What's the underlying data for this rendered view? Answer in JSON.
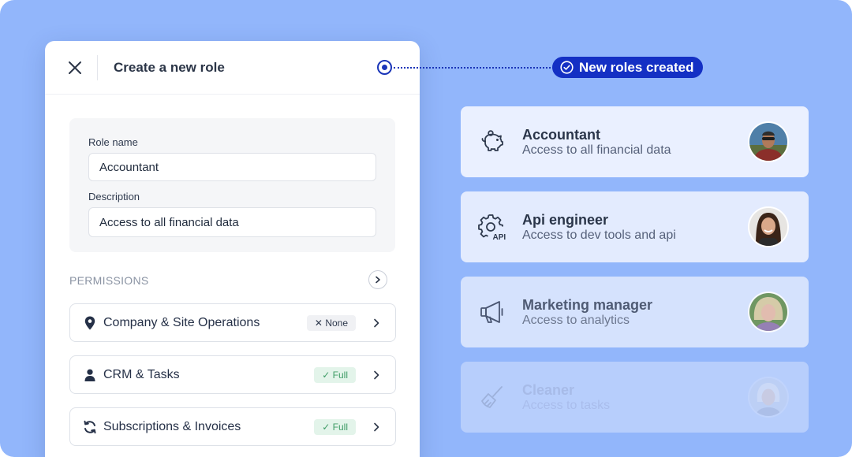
{
  "modal": {
    "title": "Create a new role",
    "form": {
      "role_name_label": "Role name",
      "role_name_value": "Accountant",
      "description_label": "Description",
      "description_value": "Access to all financial data"
    },
    "permissions": {
      "heading": "PERMISSIONS",
      "rows": [
        {
          "label": "Company & Site Operations",
          "icon": "location-pin-icon",
          "badge": "None",
          "badge_status": "none"
        },
        {
          "label": "CRM & Tasks",
          "icon": "person-icon",
          "badge": "Full",
          "badge_status": "full"
        },
        {
          "label": "Subscriptions & Invoices",
          "icon": "refresh-icon",
          "badge": "Full",
          "badge_status": "full"
        }
      ]
    }
  },
  "notification": {
    "label": "New roles created",
    "icon": "check-circle-icon"
  },
  "roles": [
    {
      "name": "Accountant",
      "description": "Access to all financial data",
      "icon": "piggy-bank-icon"
    },
    {
      "name": "Api engineer",
      "description": "Access to dev tools and api",
      "icon": "gear-api-icon",
      "icon_text": "API"
    },
    {
      "name": "Marketing manager",
      "description": "Access to analytics",
      "icon": "megaphone-icon"
    },
    {
      "name": "Cleaner",
      "description": "Access to tasks",
      "icon": "broom-icon"
    }
  ],
  "colors": {
    "background": "#92b6fb",
    "accent": "#1430c4",
    "success": "#3f9c66",
    "card": "#eaf0ff"
  }
}
